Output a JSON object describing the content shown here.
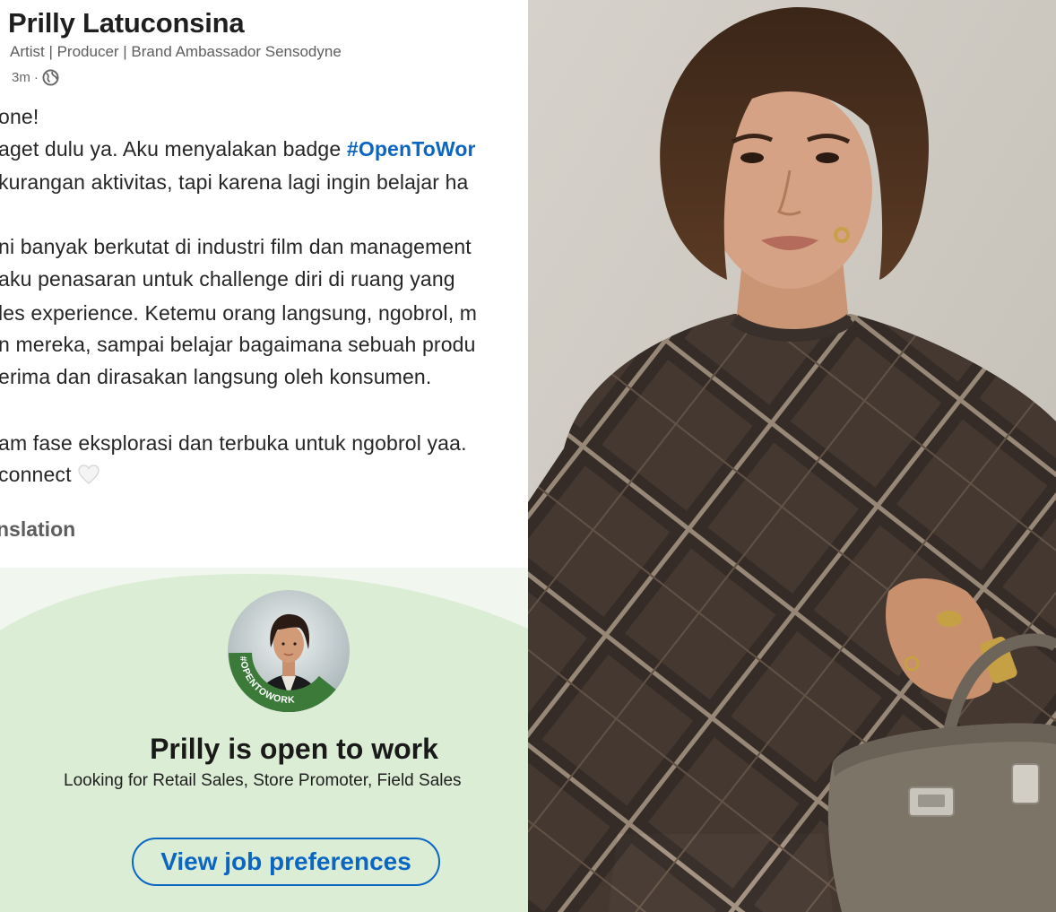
{
  "post": {
    "author": {
      "name": "Prilly Latuconsina",
      "headline": "Artist | Producer | Brand Ambassador Sensodyne",
      "time": "3m",
      "separator": "·",
      "visibility_icon": "globe-icon"
    },
    "body": {
      "line1": "one!",
      "line2_prefix": "aget dulu ya. Aku menyalakan badge ",
      "line2_hashtag": "#OpenToWor",
      "line3": "kurangan aktivitas, tapi karena lagi ingin belajar ha",
      "line4": "ni banyak berkutat di industri film dan management",
      "line5": " aku penasaran untuk challenge diri di ruang yang",
      "line6": "les experience. Ketemu orang langsung, ngobrol, m",
      "line7": "n mereka, sampai belajar bagaimana sebuah produ",
      "line8": "erima dan dirasakan langsung oleh konsumen.",
      "line9": "am fase eksplorasi dan terbuka untuk ngobrol yaa.",
      "line10": " connect",
      "heart_icon": "white-heart-icon"
    },
    "see_translation": "nslation"
  },
  "open_to_work": {
    "badge_text": "#OPENTOWORK",
    "title": "Prilly is open to work",
    "subtitle": "Looking for Retail Sales, Store Promoter, Field Sales",
    "button": "View job preferences"
  },
  "colors": {
    "accent": "#0a66c2",
    "otw_green": "#3c7a3a",
    "panel_bg": "#dcedd5"
  }
}
